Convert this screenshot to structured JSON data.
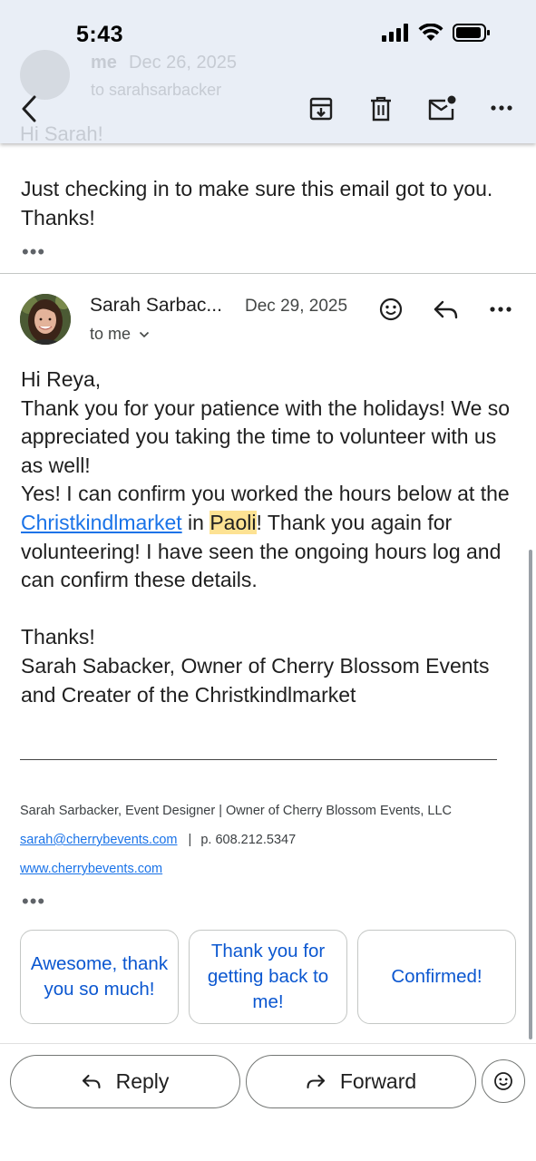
{
  "status_bar": {
    "time": "5:43"
  },
  "collapsed_message": {
    "sender": "me",
    "date": "Dec 26, 2025",
    "to_line": "to sarahsarbacker",
    "preview": "Hi Sarah!",
    "snippet": "Just checking in to make sure this email got to you. Thanks!",
    "more": "•••"
  },
  "message": {
    "sender": "Sarah Sarbac...",
    "date": "Dec 29, 2025",
    "recipient": "to me",
    "body": {
      "greeting": "Hi Reya,",
      "p1": "Thank you for your patience with the holidays! We so appreciated you taking the time to volunteer with us as well!",
      "p2_before_link": "Yes! I can confirm you worked the hours below at the ",
      "link_text": "Christkindlmarket",
      "p2_between": " in ",
      "highlight": "Paoli",
      "p2_after": "! Thank you again for volunteering! I have seen the ongoing hours log and can confirm these details.",
      "thanks": "Thanks!",
      "signoff": "Sarah Sabacker, Owner of Cherry Blossom Events and Creater of the Christkindlmarket"
    },
    "signature": {
      "line1": "Sarah Sarbacker, Event Designer | Owner of Cherry Blossom Events, LLC",
      "email": "sarah@cherrybevents.com",
      "separator": "|",
      "phone": "p. 608.212.5347",
      "website": "www.cherrybevents.com"
    },
    "more": "•••"
  },
  "smart_replies": [
    "Awesome, thank you so much!",
    "Thank you for getting back to me!",
    "Confirmed!"
  ],
  "actions": {
    "reply": "Reply",
    "forward": "Forward"
  },
  "colors": {
    "app_bar": "#e9eef6",
    "link": "#1a73e8",
    "smart_reply_text": "#0b57d0",
    "highlight": "#fde293"
  }
}
